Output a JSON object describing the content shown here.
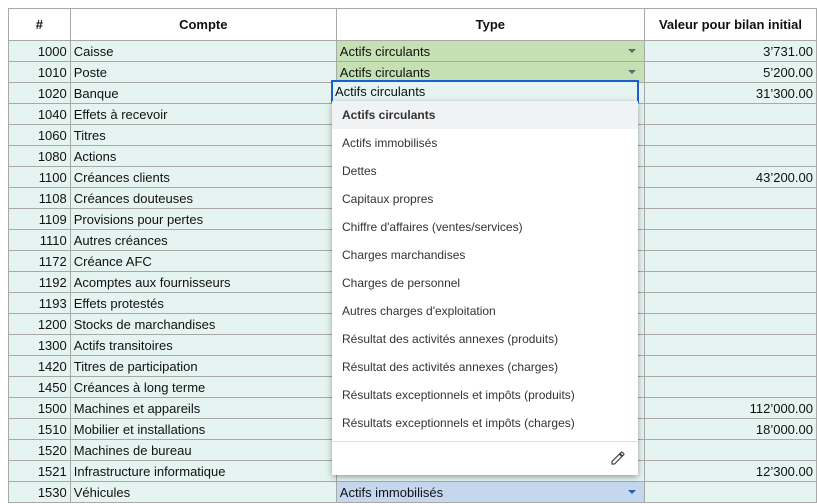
{
  "headers": {
    "num": "#",
    "account": "Compte",
    "type": "Type",
    "value": "Valeur pour bilan initial"
  },
  "rows": [
    {
      "num": "1000",
      "account": "Caisse",
      "type": "Actifs circulants",
      "value": "3’731.00"
    },
    {
      "num": "1010",
      "account": "Poste",
      "type": "Actifs circulants",
      "value": "5’200.00"
    },
    {
      "num": "1020",
      "account": "Banque",
      "type": "Actifs circulants",
      "value": "31’300.00"
    },
    {
      "num": "1040",
      "account": "Effets à recevoir",
      "type": "",
      "value": ""
    },
    {
      "num": "1060",
      "account": "Titres",
      "type": "",
      "value": ""
    },
    {
      "num": "1080",
      "account": "Actions",
      "type": "",
      "value": ""
    },
    {
      "num": "1100",
      "account": "Créances clients",
      "type": "",
      "value": "43’200.00"
    },
    {
      "num": "1108",
      "account": "Créances douteuses",
      "type": "",
      "value": ""
    },
    {
      "num": "1109",
      "account": "Provisions pour pertes",
      "type": "",
      "value": ""
    },
    {
      "num": "1110",
      "account": "Autres créances",
      "type": "",
      "value": ""
    },
    {
      "num": "1172",
      "account": "Créance AFC",
      "type": "",
      "value": ""
    },
    {
      "num": "1192",
      "account": "Acomptes aux fournisseurs",
      "type": "",
      "value": ""
    },
    {
      "num": "1193",
      "account": "Effets protestés",
      "type": "",
      "value": ""
    },
    {
      "num": "1200",
      "account": "Stocks de marchandises",
      "type": "",
      "value": ""
    },
    {
      "num": "1300",
      "account": "Actifs transitoires",
      "type": "",
      "value": ""
    },
    {
      "num": "1420",
      "account": "Titres de participation",
      "type": "",
      "value": ""
    },
    {
      "num": "1450",
      "account": "Créances à long terme",
      "type": "",
      "value": ""
    },
    {
      "num": "1500",
      "account": "Machines et appareils",
      "type": "",
      "value": "112’000.00"
    },
    {
      "num": "1510",
      "account": "Mobilier et installations",
      "type": "",
      "value": "18’000.00"
    },
    {
      "num": "1520",
      "account": "Machines de bureau",
      "type": "",
      "value": ""
    },
    {
      "num": "1521",
      "account": "Infrastructure informatique",
      "type": "",
      "value": "12’300.00"
    },
    {
      "num": "1530",
      "account": "Véhicules",
      "type": "Actifs immobilisés",
      "value": ""
    }
  ],
  "editing_value": "Actifs circulants",
  "dropdown_options": [
    "Actifs circulants",
    "Actifs immobilisés",
    "Dettes",
    "Capitaux propres",
    "Chiffre d'affaires (ventes/services)",
    "Charges marchandises",
    "Charges de personnel",
    "Autres charges d'exploitation",
    "Résultat des activités annexes (produits)",
    "Résultat des activités annexes (charges)",
    "Résultats exceptionnels et impôts (produits)",
    "Résultats exceptionnels et impôts (charges)"
  ],
  "colors": {
    "row_bg": "#e5f4f0",
    "green_chip": "#c5e0b2",
    "blue_chip": "#c4d7ef",
    "focus": "#1a5fd1"
  }
}
